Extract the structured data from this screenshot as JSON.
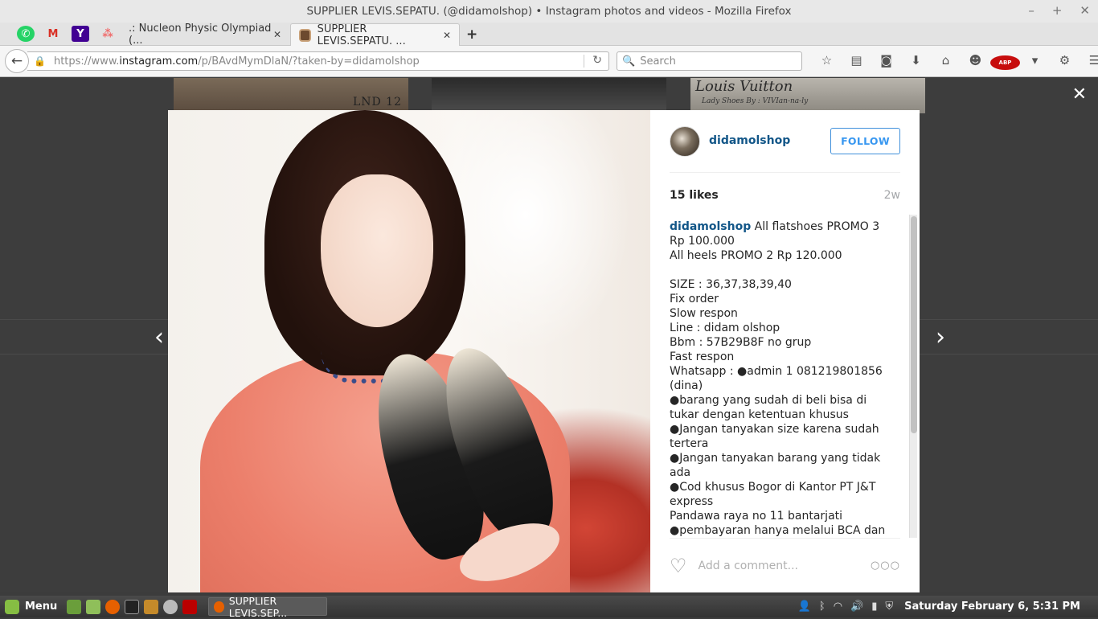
{
  "window": {
    "title": "SUPPLIER LEVIS.SEPATU. (@didamolshop) • Instagram photos and videos - Mozilla Firefox",
    "controls": [
      "–",
      "+",
      "✕"
    ]
  },
  "tabs": [
    {
      "label": ".: Nucleon Physic Olympiad (...",
      "close": "✕"
    },
    {
      "label": "SUPPLIER LEVIS.SEPATU. ...",
      "close": "✕",
      "active": true
    }
  ],
  "pinned_tabs": [
    {
      "icon": "whatsapp-icon",
      "glyph": "✆",
      "color": "#25d366"
    },
    {
      "icon": "gmail-icon",
      "glyph": "M",
      "color": "#d93025"
    },
    {
      "icon": "yahoo-icon",
      "glyph": "Y",
      "color": "#410093"
    },
    {
      "icon": "asana-icon",
      "glyph": "⁂",
      "color": "#f06a6a"
    }
  ],
  "new_tab_glyph": "+",
  "navbar": {
    "url_prefix": "https://www.",
    "url_host": "instagram.com",
    "url_path": "/p/BAvdMymDlaN/?taken-by=didamolshop",
    "search_placeholder": "Search"
  },
  "page": {
    "thumb1_text": "LND 12",
    "thumb3_title": "Louis Vuitton",
    "thumb3_sub": "Lady Shoes By : VIVIan-na-ly"
  },
  "post": {
    "username": "didamolshop",
    "follow_label": "FOLLOW",
    "likes": "15 likes",
    "age": "2w",
    "caption_user": "didamolshop",
    "caption_text": " All flatshoes PROMO 3 Rp 100.000\nAll heels PROMO 2 Rp 120.000\n\nSIZE : 36,37,38,39,40\nFix order\nSlow respon\nLine : didam olshop\nBbm : 57B29B8F no grup\nFast respon\nWhatsapp : ●admin 1 081219801856 (dina)\n●barang yang sudah di beli bisa di tukar dengan ketentuan khusus ●Jangan tanyakan size karena sudah tertera\n●Jangan tanyakan barang yang tidak ada\n●Cod khusus Bogor di Kantor PT J&T express\nPandawa raya no 11 bantarjati\n●pembayaran hanya melalui BCA dan Mandiri\nUntuk info lebih lanjut langsung chat ya",
    "comment_placeholder": "Add a comment...",
    "more_glyph": "○○○"
  },
  "taskbar": {
    "menu_label": "Menu",
    "window_label": "SUPPLIER LEVIS.SEP...",
    "clock": "Saturday February  6,  5:31 PM"
  },
  "colors": {
    "ig_blue": "#125688",
    "follow_blue": "#3897f0",
    "backdrop": "#3d3d3d"
  }
}
